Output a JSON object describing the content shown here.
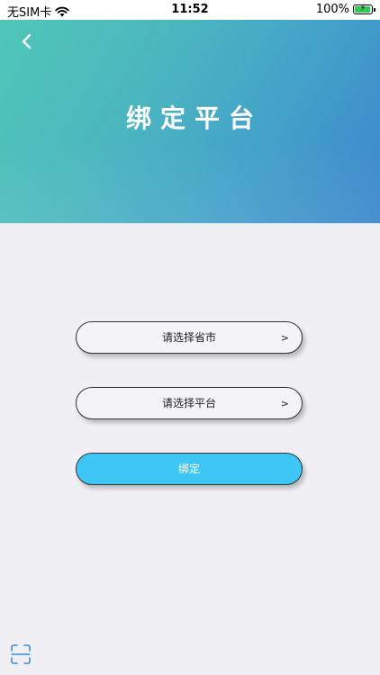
{
  "status_bar": {
    "carrier": "无SIM卡",
    "time": "11:52",
    "battery": "100%",
    "battery_level": 1.0
  },
  "header": {
    "title": "绑定平台",
    "back_icon": "chevron-left-icon"
  },
  "form": {
    "province_placeholder": "请选择省市",
    "platform_placeholder": "请选择平台",
    "arrow": ">",
    "bind_label": "绑定"
  },
  "footer": {
    "scan_icon": "scan-icon"
  },
  "colors": {
    "accent": "#3ec7f5",
    "header_start": "#4fc7b8",
    "header_end": "#3b86cc",
    "battery_charging": "#32c759",
    "background": "#efeff4"
  }
}
